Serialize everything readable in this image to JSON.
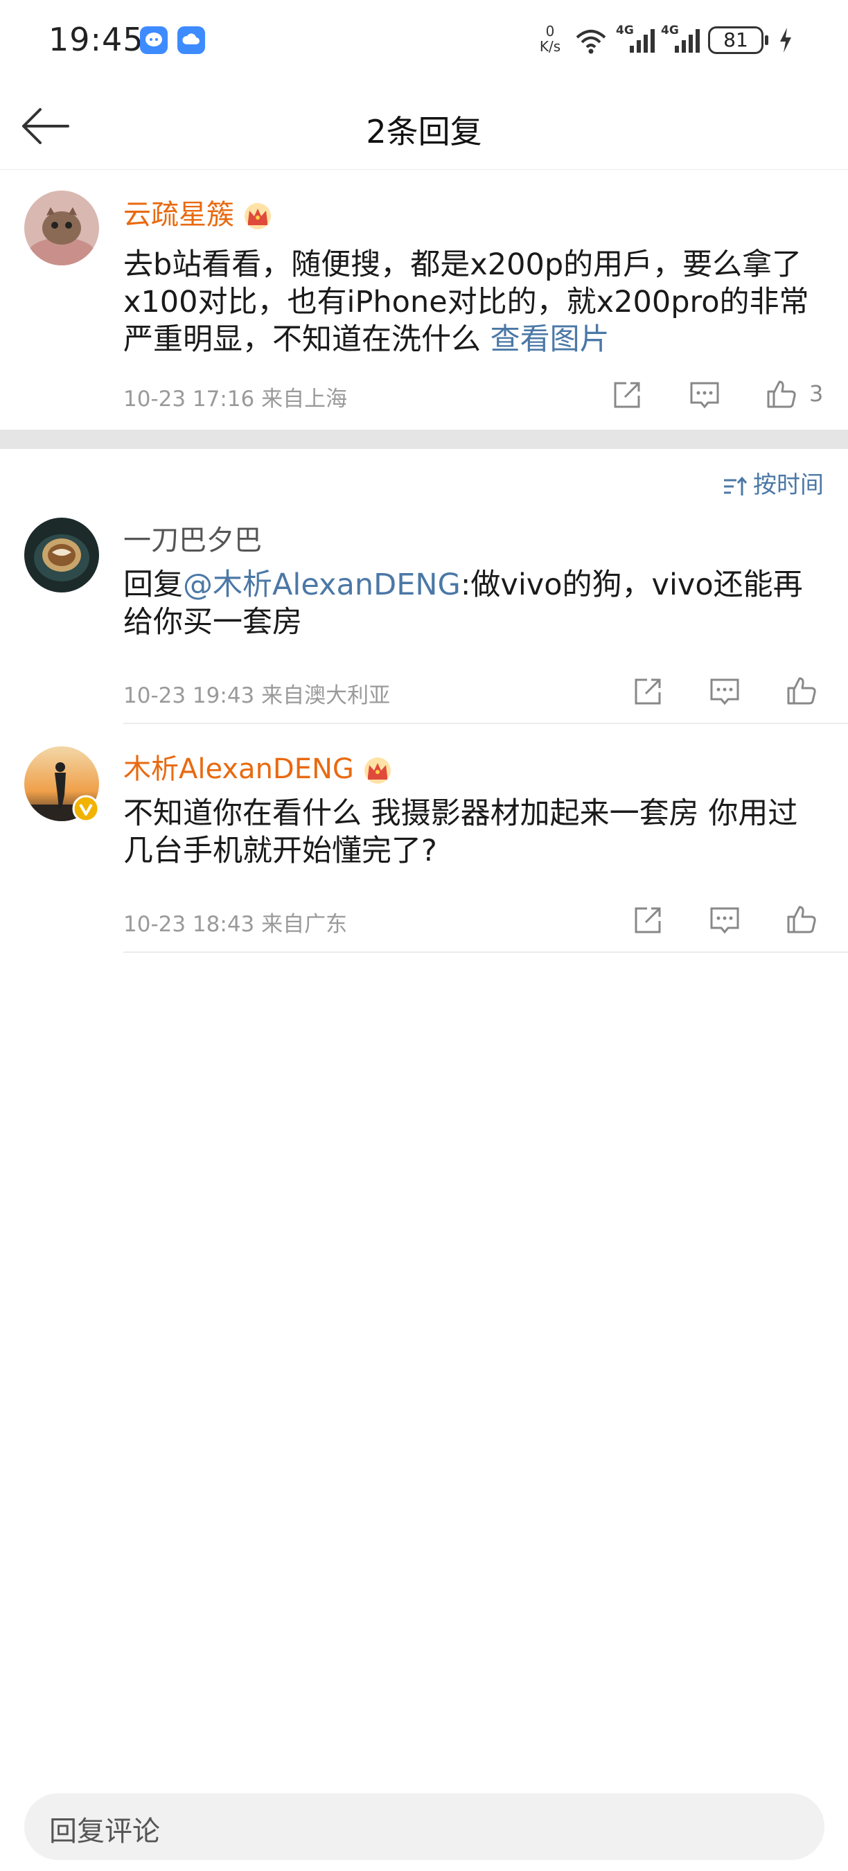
{
  "status_bar": {
    "time": "19:45",
    "net_speed_value": "0",
    "net_speed_unit": "K/s",
    "signal_label_1": "4G",
    "signal_label_2": "4G",
    "battery": "81"
  },
  "nav": {
    "title": "2条回复",
    "back_icon": "arrow-left-icon"
  },
  "main_comment": {
    "username": "云疏星簇",
    "text_prefix": "去b站看看，随便搜，都是x200p的用戶，要么拿了x100对比，也有iPhone对比的，就x200pro的非常严重明显，不知道在洗什么 ",
    "link_text": "查看图片",
    "time": "10-23 17:16",
    "location": "来自上海",
    "like_count": "3"
  },
  "sort": {
    "label": "按时间"
  },
  "replies": [
    {
      "username": "一刀巴夕巴",
      "reply_prefix": "回复",
      "mention": "@木析AlexanDENG",
      "text": ":做vivo的狗，vivo还能再给你买一套房",
      "time": "10-23 19:43",
      "location": "来自澳大利亚"
    },
    {
      "username": "木析AlexanDENG",
      "text": "不知道你在看什么 我摄影器材加起来一套房 你用过几台手机就开始懂完了?",
      "time": "10-23 18:43",
      "location": "来自广东"
    }
  ],
  "reply_bar": {
    "placeholder": "回复评论"
  },
  "colors": {
    "username_accent": "#e86a10",
    "link": "#4b78a6",
    "meta_gray": "#9a9a9a",
    "vip_badge": "#f2b200"
  }
}
